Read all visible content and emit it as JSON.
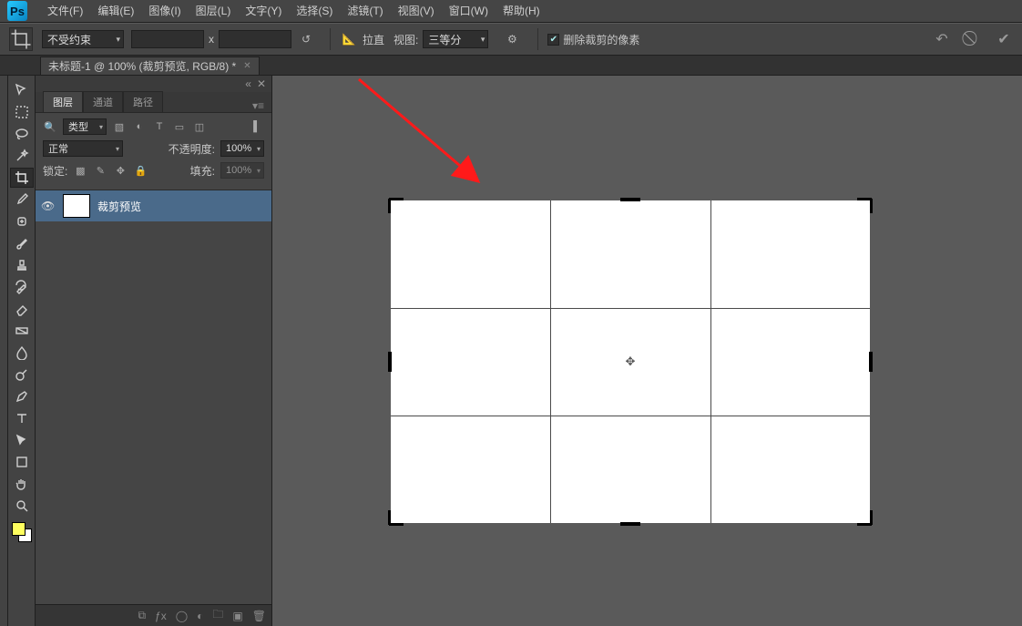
{
  "menu": {
    "items": [
      "文件(F)",
      "编辑(E)",
      "图像(I)",
      "图层(L)",
      "文字(Y)",
      "选择(S)",
      "滤镜(T)",
      "视图(V)",
      "窗口(W)",
      "帮助(H)"
    ]
  },
  "options": {
    "constraint": "不受约束",
    "x_label": "x",
    "straighten": "拉直",
    "view_label": "视图:",
    "view_value": "三等分",
    "delete_cropped": "删除裁剪的像素"
  },
  "doc": {
    "title": "未标题-1 @ 100% (裁剪预览, RGB/8) *"
  },
  "panels": {
    "tabs": [
      "图层",
      "通道",
      "路径"
    ],
    "filter_kind": "类型",
    "blend_mode": "正常",
    "opacity_label": "不透明度:",
    "opacity_value": "100%",
    "lock_label": "锁定:",
    "fill_label": "填充:",
    "fill_value": "100%",
    "layer_name": "裁剪预览"
  },
  "logo": "Ps"
}
